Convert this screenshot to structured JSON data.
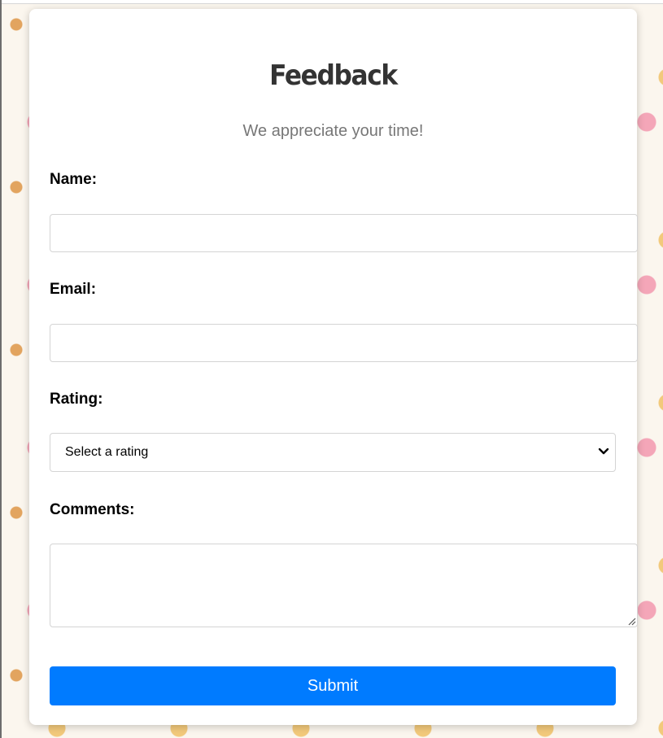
{
  "form": {
    "title": "Feedback",
    "subtitle": "We appreciate your time!",
    "name_label": "Name:",
    "name_value": "",
    "email_label": "Email:",
    "email_value": "",
    "rating_label": "Rating:",
    "rating_selected": "Select a rating",
    "comments_label": "Comments:",
    "comments_value": "",
    "submit_label": "Submit"
  },
  "colors": {
    "primary_button": "#007bff",
    "title_text": "#333333",
    "subtitle_text": "#777777",
    "card_background": "#ffffff"
  },
  "icons": {
    "select_arrow": "chevron-down-icon",
    "textarea_resize": "resize-handle-icon"
  }
}
